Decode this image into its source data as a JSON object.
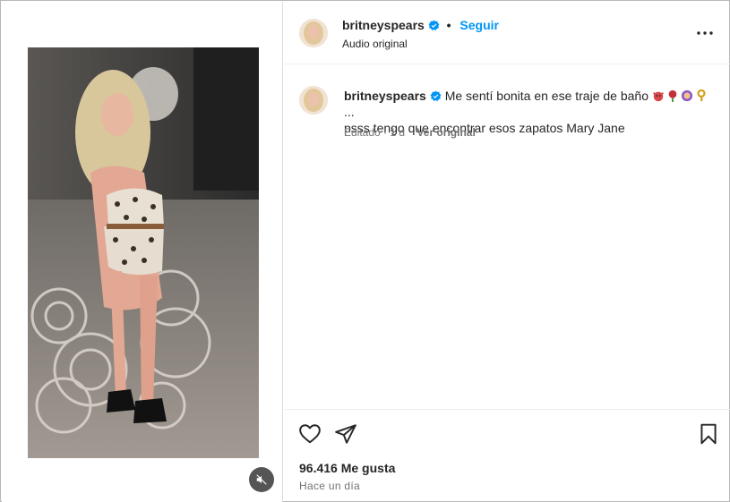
{
  "post": {
    "username": "britneyspears",
    "separator": "•",
    "follow_label": "Seguir",
    "audio_label": "Audio original",
    "more_label": "•••"
  },
  "caption": {
    "username": "britneyspears",
    "text_line1": "Me sentí bonita en ese traje de baño",
    "trailing": "...",
    "text_line2": "psss tengo que encontrar esos zapatos Mary Jane",
    "edited_label": "Editado",
    "meta_sep": "·",
    "age": "1 d",
    "see_original_label": "Ver original",
    "emojis": [
      "devil-emoji",
      "rose-emoji",
      "woman-emoji",
      "key-emoji"
    ]
  },
  "stats": {
    "likes_label": "96.416 Me gusta",
    "posted_label": "Hace un día"
  },
  "icons": {
    "heart": "heart-icon",
    "share": "paper-plane-icon",
    "save": "bookmark-icon",
    "mute": "speaker-muted-icon",
    "verified": "verified-badge-icon"
  },
  "colors": {
    "accent": "#0095f6",
    "verified": "#0095f6",
    "text": "#262626",
    "muted": "#737373"
  }
}
